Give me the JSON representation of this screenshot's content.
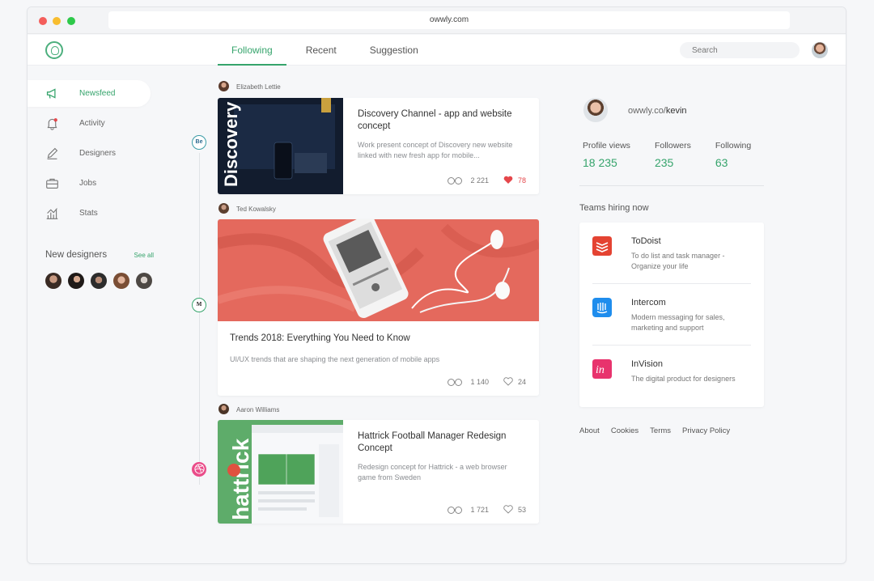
{
  "browser": {
    "url": "owwly.com"
  },
  "header": {
    "tabs": [
      {
        "label": "Following"
      },
      {
        "label": "Recent"
      },
      {
        "label": "Suggestion"
      }
    ],
    "search_placeholder": "Search"
  },
  "sidebar": {
    "items": [
      {
        "label": "Newsfeed",
        "icon": "megaphone-icon"
      },
      {
        "label": "Activity",
        "icon": "bell-icon"
      },
      {
        "label": "Designers",
        "icon": "pencil-icon"
      },
      {
        "label": "Jobs",
        "icon": "briefcase-icon"
      },
      {
        "label": "Stats",
        "icon": "chart-icon"
      }
    ],
    "new_designers": {
      "title": "New designers",
      "see_all": "See all"
    }
  },
  "feed": {
    "posts": [
      {
        "source_badge": "Be",
        "author": "Elizabeth Lettie",
        "title": "Discovery Channel - app and website concept",
        "description": "Work present concept of Discovery new website linked with new fresh app for mobile...",
        "views": "2 221",
        "likes": "78",
        "liked": true
      },
      {
        "source_badge": "M",
        "author": "Ted Kowalsky",
        "title": "Trends 2018: Everything You Need to Know",
        "description": "UI/UX trends that are shaping the next generation of mobile apps",
        "views": "1 140",
        "likes": "24",
        "liked": false
      },
      {
        "source_badge": "",
        "author": "Aaron Williams",
        "title": "Hattrick Football Manager Redesign Concept",
        "description": "Redesign concept for Hattrick - a web browser game from Sweden",
        "views": "1 721",
        "likes": "53",
        "liked": false
      }
    ]
  },
  "profile": {
    "link_prefix": "owwly.co/",
    "username": "kevin",
    "stats": [
      {
        "label": "Profile views",
        "value": "18 235"
      },
      {
        "label": "Followers",
        "value": "235"
      },
      {
        "label": "Following",
        "value": "63"
      }
    ]
  },
  "teams": {
    "title": "Teams hiring now",
    "items": [
      {
        "name": "ToDoist",
        "description": "To do list and task manager - Organize your life",
        "color": "#e44332"
      },
      {
        "name": "Intercom",
        "description": "Modern messaging for sales, marketing and support",
        "color": "#1f8ded"
      },
      {
        "name": "InVision",
        "description": "The digital product for designers",
        "color": "#e8336d"
      }
    ]
  },
  "footer": {
    "links": [
      "About",
      "Cookies",
      "Terms",
      "Privacy Policy"
    ]
  },
  "colors": {
    "accent": "#36a46c",
    "like": "#e5474b"
  }
}
